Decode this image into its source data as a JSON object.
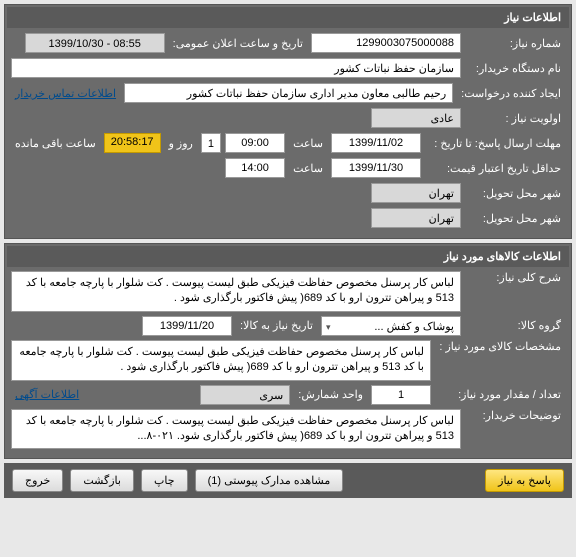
{
  "panel1": {
    "title": "اطلاعات نیاز",
    "req_no_lbl": "شماره نیاز:",
    "req_no": "1299003075000088",
    "announce_lbl": "تاریخ و ساعت اعلان عمومی:",
    "announce_val": "1399/10/30 - 08:55",
    "buyer_lbl": "نام دستگاه خریدار:",
    "buyer_val": "سازمان حفظ نباتات کشور",
    "creator_lbl": "ایجاد کننده درخواست:",
    "creator_val": "رحیم طالبی معاون مدیر اداری سازمان حفظ نباتات کشور",
    "contact_link": "اطلاعات تماس خریدار",
    "priority_lbl": "اولویت نیاز :",
    "priority_val": "عادی",
    "deadline_lbl": "مهلت ارسال پاسخ:  تا تاریخ :",
    "deadline_date": "1399/11/02",
    "time_lbl": "ساعت",
    "deadline_time": "09:00",
    "days_val": "1",
    "days_lbl": "روز و",
    "remain_time": "20:58:17",
    "remain_lbl": "ساعت باقی مانده",
    "min_valid_lbl": "حداقل تاریخ اعتبار قیمت:",
    "min_valid_date": "1399/11/30",
    "min_valid_time": "14:00",
    "delivery_city_lbl": "شهر محل تحویل:",
    "delivery_city": "تهران",
    "delivery_loc_lbl": "شهر محل تحویل:",
    "delivery_loc": "تهران"
  },
  "panel2": {
    "title": "اطلاعات کالاهای مورد نیاز",
    "general_desc_lbl": "شرح کلی نیاز:",
    "general_desc": "لباس کار پرسنل مخصوص حفاظت فیزیکی طبق لیست پیوست . کت شلوار با پارچه جامعه با کد 513 و پیراهن تترون ارو با کد 689( پیش فاکتور بارگذاری شود .",
    "group_lbl": "گروه کالا:",
    "group_val": "پوشاک و کفش ...",
    "date_to_lbl": "تاریخ نیاز به کالا:",
    "date_to_val": "1399/11/20",
    "spec_lbl": "مشخصات کالای مورد نیاز :",
    "spec_val": "لباس کار پرسنل مخصوص حفاظت فیزیکی طبق لیست پیوست . کت شلوار با پارچه جامعه با کد 513 و پیراهن تترون ارو با کد 689( پیش فاکتور بارگذاری شود .",
    "qty_lbl": "تعداد / مقدار مورد نیاز:",
    "qty_val": "1",
    "unit_lbl": "واحد شمارش:",
    "unit_val": "سری",
    "info_link": "اطلاعات آگهی",
    "buyer_desc_lbl": "توضیحات خریدار:",
    "buyer_desc": "لباس کار پرسنل مخصوص حفاظت فیزیکی طبق لیست پیوست . کت شلوار با پارچه جامعه با کد 513 و پیراهن تترون ارو با کد 689( پیش فاکتور بارگذاری شود. ۰۲۱-۸..."
  },
  "footer": {
    "respond": "پاسخ به نیاز",
    "attach": "مشاهده مدارک پیوستی  (1)",
    "print": "چاپ",
    "back": "بازگشت",
    "exit": "خروج"
  }
}
